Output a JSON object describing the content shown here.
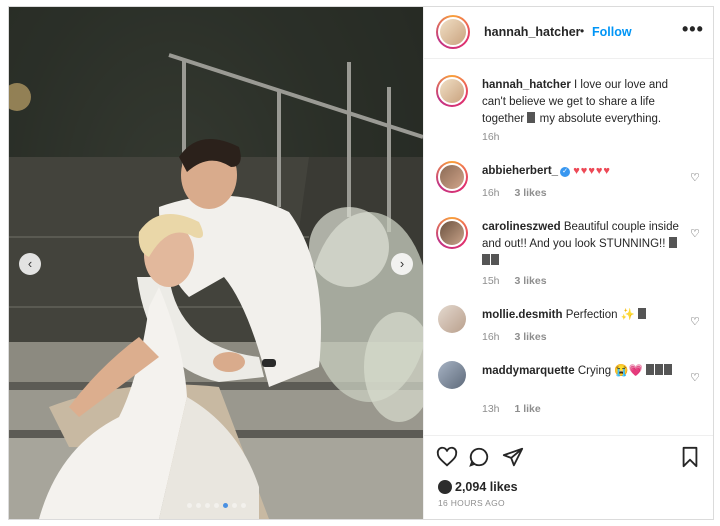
{
  "post": {
    "username": "hannah_hatcher",
    "separator": "•",
    "follow_label": "Follow",
    "more_label": "•••",
    "caption_text": "I love our love and can't believe we get to share a life together",
    "caption_tail": "my absolute everything.",
    "caption_time": "16h",
    "carousel_prev": "‹",
    "carousel_next": "›"
  },
  "comments": [
    {
      "username": "abbieherbert_",
      "text": "♥♥♥♥♥",
      "time": "16h",
      "likes": "3 likes",
      "verified": "✓"
    },
    {
      "username": "carolineszwed",
      "text": "Beautiful couple inside and out!! And you look STUNNING!!",
      "time": "15h",
      "likes": "3 likes"
    },
    {
      "username": "mollie.desmith",
      "text": "Perfection ✨",
      "time": "16h",
      "likes": "3 likes"
    },
    {
      "username": "maddymarquette",
      "text": "Crying 😭💗",
      "time": "13h",
      "likes": "1 like"
    }
  ],
  "footer": {
    "likes_count": "2,094 likes",
    "time_ago": "16 HOURS AGO"
  },
  "colors": {
    "accent": "#0095f6",
    "heart_red": "#ed4956",
    "muted": "#8e8e8e"
  },
  "icons": [
    "more-icon",
    "heart-icon",
    "comment-icon",
    "share-icon",
    "bookmark-icon",
    "verified-icon",
    "chevron-left-icon",
    "chevron-right-icon"
  ]
}
